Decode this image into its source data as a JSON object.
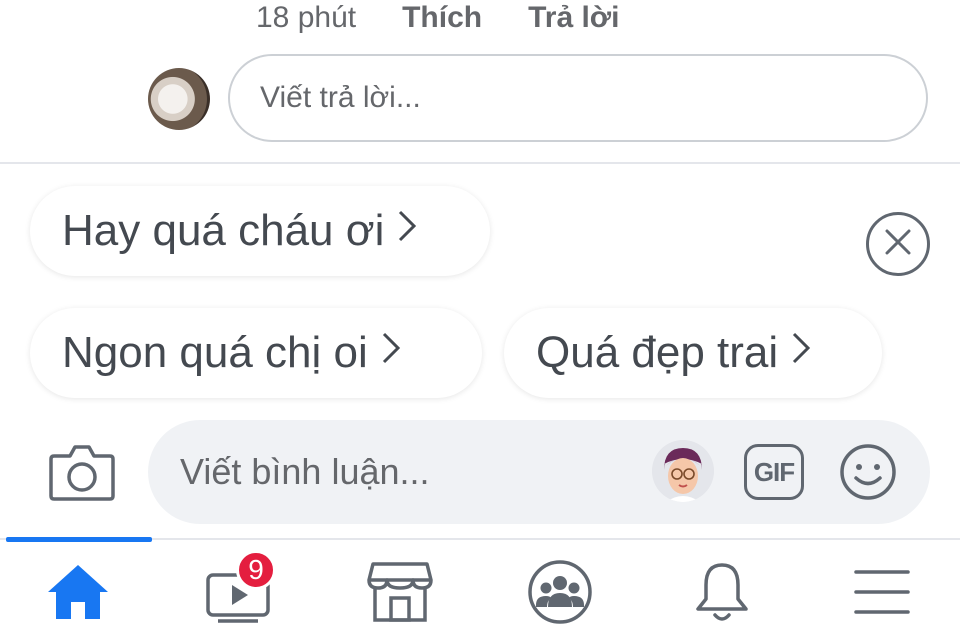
{
  "reply_meta": {
    "time": "18 phút",
    "like_label": "Thích",
    "reply_label": "Trả lời"
  },
  "reply_input": {
    "placeholder": "Viết trả lời..."
  },
  "suggestions": [
    {
      "label": "Hay quá cháu ơi"
    },
    {
      "label": "Ngon quá chị oi"
    },
    {
      "label": "Quá đẹp trai"
    }
  ],
  "comment_input": {
    "placeholder": "Viết bình luận..."
  },
  "gif_label": "GIF",
  "nav": {
    "items": [
      {
        "name": "home",
        "icon": "home-icon",
        "active": true
      },
      {
        "name": "watch",
        "icon": "video-icon",
        "badge": "9"
      },
      {
        "name": "marketplace",
        "icon": "store-icon"
      },
      {
        "name": "groups",
        "icon": "groups-icon"
      },
      {
        "name": "notifications",
        "icon": "bell-icon"
      },
      {
        "name": "menu",
        "icon": "menu-icon"
      }
    ]
  },
  "colors": {
    "accent": "#1877f2",
    "badge": "#e41e3f",
    "text_secondary": "#65676b"
  }
}
